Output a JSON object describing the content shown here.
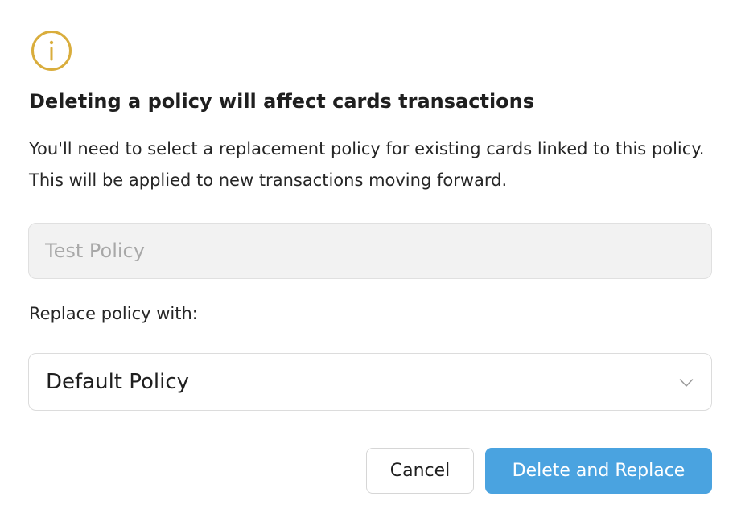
{
  "colors": {
    "info_icon": "#d9ad3c",
    "primary_button": "#4aa3e0",
    "disabled_field_bg": "#f2f2f2"
  },
  "dialog": {
    "icon": "info-circle-icon",
    "title": "Deleting a policy will affect cards transactions",
    "description": "You'll need to select a replacement policy for existing cards linked to this policy. This will be applied to new transactions moving forward.",
    "current_policy_field": {
      "placeholder": "Test Policy",
      "disabled": true
    },
    "replace_label": "Replace policy with:",
    "replacement_select": {
      "selected": "Default Policy",
      "icon": "chevron-down-icon"
    },
    "buttons": {
      "cancel": "Cancel",
      "confirm": "Delete and Replace"
    }
  }
}
